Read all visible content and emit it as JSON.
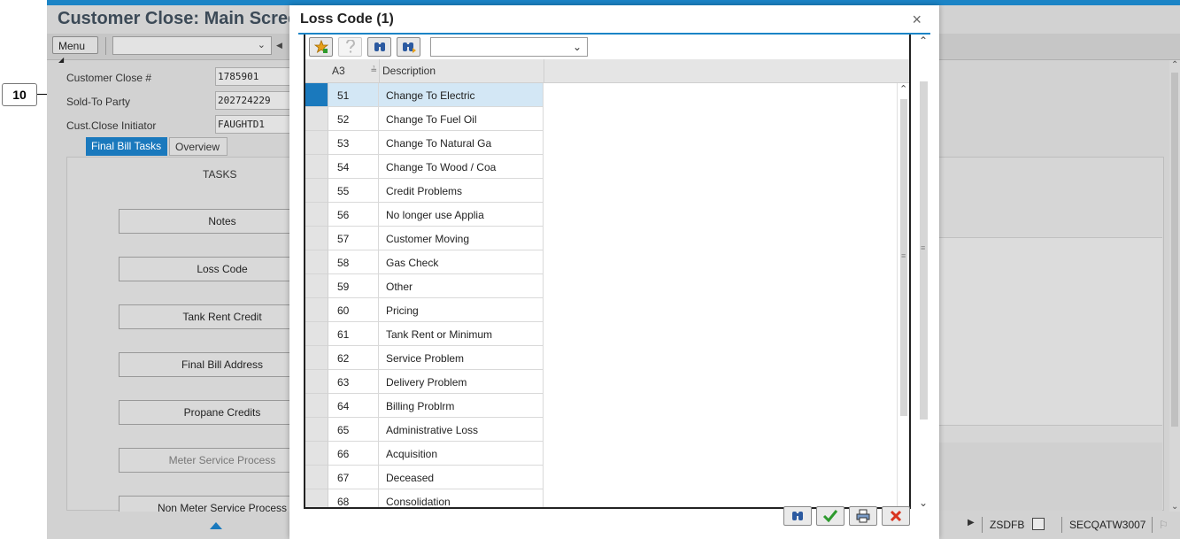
{
  "background": {
    "title": "Customer Close: Main Scree",
    "menu_label": "Menu",
    "fields": [
      {
        "label": "Customer Close #",
        "value": "1785901"
      },
      {
        "label": "Sold-To Party",
        "value": "202724229"
      },
      {
        "label": "Cust.Close Initiator",
        "value": "FAUGHTD1"
      }
    ],
    "tabs": [
      {
        "label": "Final Bill Tasks",
        "active": true
      },
      {
        "label": "Overview",
        "active": false
      }
    ],
    "tasks_header": "TASKS",
    "tasks": [
      {
        "label": "Notes",
        "enabled": true
      },
      {
        "label": "Loss Code",
        "enabled": true
      },
      {
        "label": "Tank Rent Credit",
        "enabled": true
      },
      {
        "label": "Final Bill Address",
        "enabled": true
      },
      {
        "label": "Propane Credits",
        "enabled": true
      },
      {
        "label": "Meter Service Process",
        "enabled": false
      },
      {
        "label": "Non Meter Service Process",
        "enabled": true
      }
    ],
    "status_bar": {
      "transaction": "ZSDFB",
      "system": "SECQATW3007"
    }
  },
  "callout": {
    "number": "10"
  },
  "dialog": {
    "title": "Loss Code (1)",
    "close_glyph": "×",
    "columns": [
      {
        "label": "A3"
      },
      {
        "label": "Description"
      }
    ],
    "sort_indicator": "≟",
    "selected_row": 0,
    "rows": [
      {
        "code": "51",
        "description": "Change To Electric"
      },
      {
        "code": "52",
        "description": "Change To Fuel Oil"
      },
      {
        "code": "53",
        "description": "Change To Natural Ga"
      },
      {
        "code": "54",
        "description": "Change To Wood / Coa"
      },
      {
        "code": "55",
        "description": "Credit Problems"
      },
      {
        "code": "56",
        "description": "No longer use Applia"
      },
      {
        "code": "57",
        "description": "Customer Moving"
      },
      {
        "code": "58",
        "description": "Gas Check"
      },
      {
        "code": "59",
        "description": "Other"
      },
      {
        "code": "60",
        "description": "Pricing"
      },
      {
        "code": "61",
        "description": "Tank Rent or Minimum"
      },
      {
        "code": "62",
        "description": "Service Problem"
      },
      {
        "code": "63",
        "description": "Delivery Problem"
      },
      {
        "code": "64",
        "description": "Billing Problrm"
      },
      {
        "code": "65",
        "description": "Administrative Loss"
      },
      {
        "code": "66",
        "description": "Acquisition"
      },
      {
        "code": "67",
        "description": "Deceased"
      },
      {
        "code": "68",
        "description": "Consolidation"
      }
    ],
    "toolbar_icons": [
      "favorite-add-icon",
      "help-icon",
      "find-icon",
      "find-next-icon"
    ],
    "footer_icons": [
      "find-icon",
      "confirm-check-icon",
      "print-icon",
      "cancel-x-icon"
    ],
    "colors": {
      "accent": "#1b84c6",
      "selected_row": "#d3e7f5",
      "selected_marker": "#1a79bd",
      "confirm": "#2e9a2e",
      "cancel": "#d9341f"
    }
  }
}
